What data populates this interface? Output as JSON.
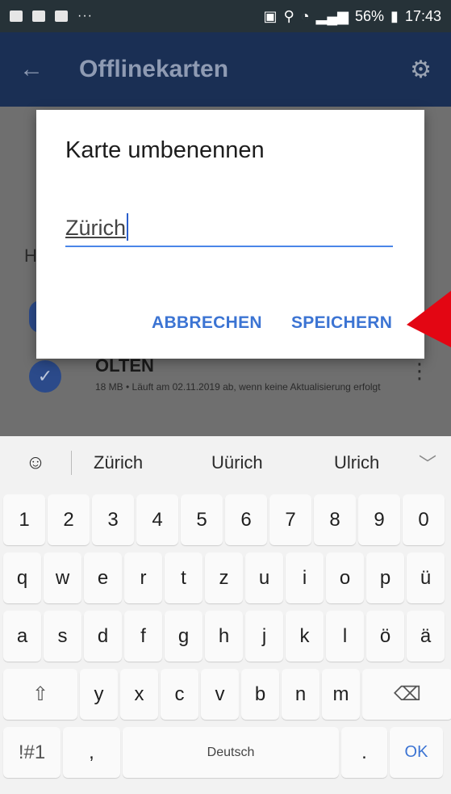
{
  "status_bar": {
    "dots": "···",
    "battery": "56%",
    "time": "17:43"
  },
  "app_bar": {
    "title": "Offlinekarten"
  },
  "background": {
    "header_letter": "H",
    "map_row": {
      "name": "OLTEN",
      "description": "18 MB • Läuft am 02.11.2019 ab, wenn keine Aktualisierung erfolgt"
    }
  },
  "dialog": {
    "title": "Karte umbenennen",
    "input_value": "Zürich",
    "cancel_label": "ABBRECHEN",
    "save_label": "SPEICHERN"
  },
  "keyboard": {
    "suggestions": [
      "Zürich",
      "Uürich",
      "Ulrich"
    ],
    "row_numbers": [
      "1",
      "2",
      "3",
      "4",
      "5",
      "6",
      "7",
      "8",
      "9",
      "0"
    ],
    "row_q": [
      "q",
      "w",
      "e",
      "r",
      "t",
      "z",
      "u",
      "i",
      "o",
      "p",
      "ü"
    ],
    "row_a": [
      "a",
      "s",
      "d",
      "f",
      "g",
      "h",
      "j",
      "k",
      "l",
      "ö",
      "ä"
    ],
    "row_y": [
      "y",
      "x",
      "c",
      "v",
      "b",
      "n",
      "m"
    ],
    "symbols_label": "!#1",
    "comma_label": ",",
    "space_label": "Deutsch",
    "period_label": ".",
    "ok_label": "OK"
  },
  "colors": {
    "accent": "#3c74d3",
    "annotation_arrow": "#e30613"
  }
}
